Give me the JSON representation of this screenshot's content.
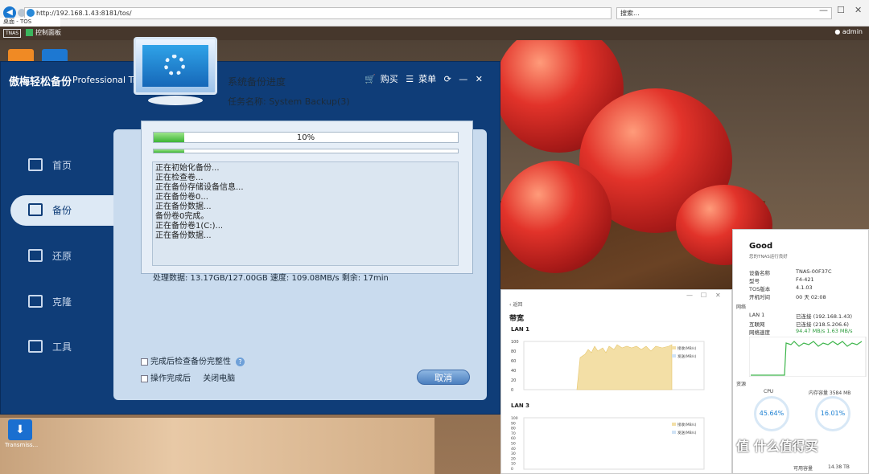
{
  "browser": {
    "address": "http://192.168.1.43:8181/tos/",
    "search_placeholder": "搜索...",
    "tabs": [
      "桌面 - TOS",
      "控制面板"
    ]
  },
  "desktop": {
    "logo_text": "TERRAMASTER",
    "control_panel_label": "控制面板",
    "user": "admin",
    "transmission_label": "Transmiss...",
    "watermark": "值 什么值得买"
  },
  "app": {
    "title": "傲梅轻松备份",
    "edition": "Professional Trial",
    "buy_label": "购买",
    "menu_label": "菜单",
    "sidebar": [
      {
        "label": "首页"
      },
      {
        "label": "备份"
      },
      {
        "label": "还原"
      },
      {
        "label": "克隆"
      },
      {
        "label": "工具"
      }
    ],
    "panel_title": "系统备份进度",
    "task_name": "任务名称: System Backup(3)",
    "progress_text": "10%",
    "progress_value": 0.1,
    "log_lines": [
      "正在初始化备份...",
      "正在检查卷...",
      "正在备份存储设备信息...",
      "正在备份卷0...",
      "正在备份数据...",
      "备份卷0完成。",
      "正在备份卷1(C:)...",
      "正在备份数据..."
    ],
    "stats": "处理数据: 13.17GB/127.00GB   速度: 109.08MB/s   剩余: 17min",
    "check_integrity": "完成后检查备份完整性",
    "after_complete": "操作完成后",
    "shutdown": "关闭电脑",
    "cancel_label": "取消"
  },
  "bandwidth": {
    "back_label": "返回",
    "title": "带宽",
    "lan1": "LAN 1",
    "lan3": "LAN 3",
    "legend_rx": "接收(MB/s)",
    "legend_tx": "发送(MB/s)",
    "y_ticks_lan1": [
      "100",
      "80",
      "60",
      "40",
      "20",
      "0"
    ],
    "y_ticks_lan3": [
      "100",
      "90",
      "80",
      "70",
      "60",
      "50",
      "40",
      "30",
      "20",
      "10",
      "0"
    ]
  },
  "status": {
    "headline": "Good",
    "subtitle": "您的TNAS运行良好",
    "rows": [
      {
        "label": "设备名称",
        "value": "TNAS-00F37C"
      },
      {
        "label": "型号",
        "value": "F4-421"
      },
      {
        "label": "TOS版本",
        "value": "4.1.03"
      },
      {
        "label": "开机时间",
        "value": "00 天 02:08"
      }
    ],
    "network_label": "网络",
    "net_rows": [
      {
        "label": "LAN 1",
        "value": "已连接 (192.168.1.43)"
      },
      {
        "label": "互联网",
        "value": "已连接 (218.5.206.6)"
      },
      {
        "label": "网络速度",
        "value": "94.47 MB/s   1.63 MB/s"
      }
    ],
    "resource_label": "资源",
    "cpu_label": "CPU",
    "cpu_value": "45.64%",
    "mem_label": "内存容量 3584 MB",
    "mem_value": "16.01%",
    "available_label": "可用容量",
    "available_value": "14.38 TB"
  }
}
